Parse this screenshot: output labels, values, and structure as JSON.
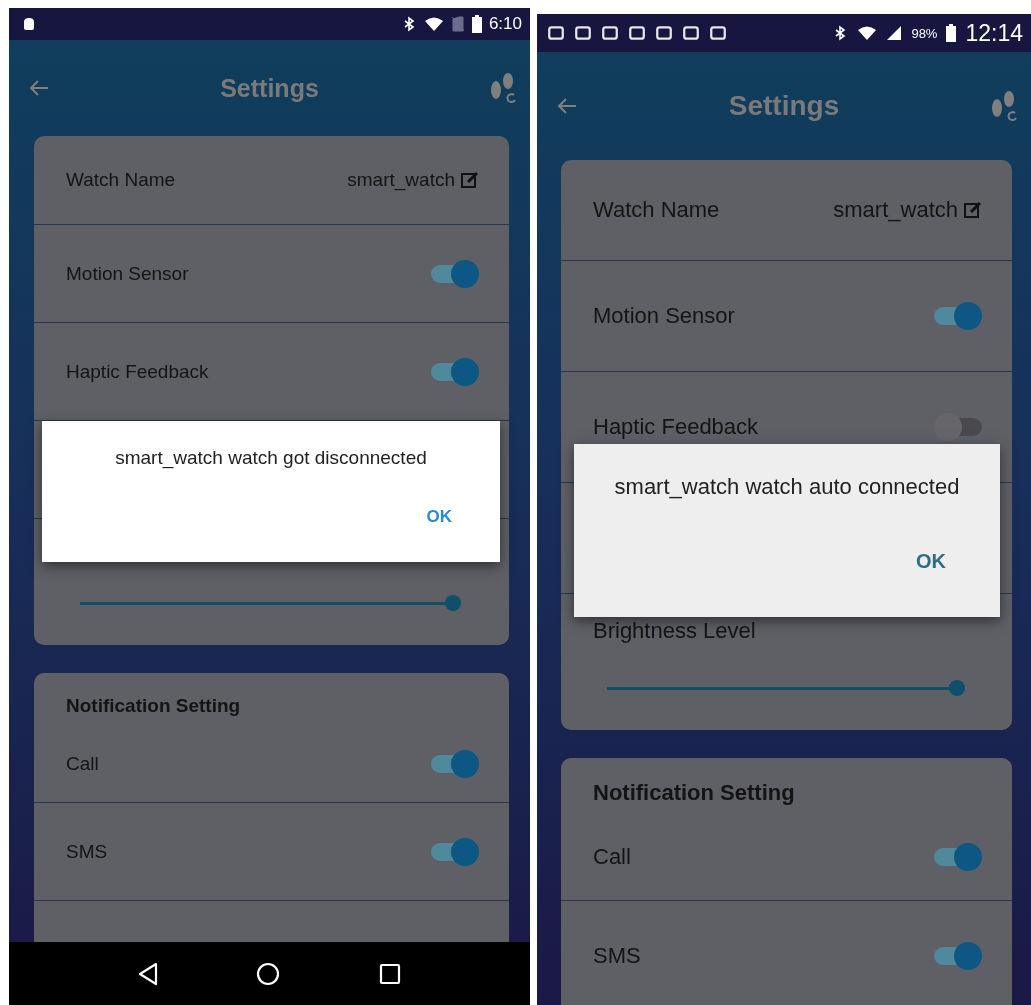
{
  "phones": [
    {
      "status_bar": {
        "time": "6:10"
      },
      "header": {
        "title": "Settings"
      },
      "watch_name": {
        "label": "Watch Name",
        "value": "smart_watch"
      },
      "toggles": [
        {
          "label": "Motion Sensor",
          "on": true
        },
        {
          "label": "Haptic Feedback",
          "on": true
        }
      ],
      "brightness": {
        "level": 0.98
      },
      "notification": {
        "title": "Notification Setting",
        "toggles": [
          {
            "label": "Call",
            "on": true
          },
          {
            "label": "SMS",
            "on": true
          }
        ]
      },
      "dialog": {
        "message": "smart_watch watch got disconnected",
        "button": "OK"
      },
      "nav_bar": true
    },
    {
      "status_bar": {
        "battery_percent": "98%",
        "time": "12:14"
      },
      "header": {
        "title": "Settings"
      },
      "watch_name": {
        "label": "Watch Name",
        "value": "smart_watch"
      },
      "toggles": [
        {
          "label": "Motion Sensor",
          "on": true
        },
        {
          "label": "Haptic Feedback",
          "on": false
        }
      ],
      "brightness": {
        "label": "Brightness Level",
        "level": 0.98
      },
      "notification": {
        "title": "Notification Setting",
        "toggles": [
          {
            "label": "Call",
            "on": true
          },
          {
            "label": "SMS",
            "on": true
          }
        ]
      },
      "dialog": {
        "message": "smart_watch watch auto connected",
        "button": "OK"
      }
    }
  ]
}
